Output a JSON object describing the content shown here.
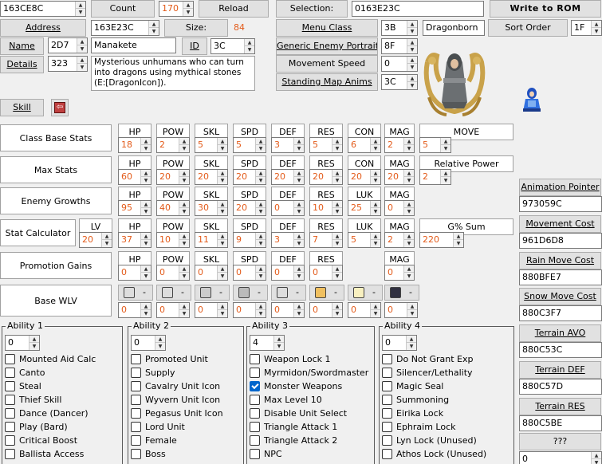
{
  "top": {
    "address_value": "163CE8C",
    "count_label": "Count",
    "count_value": "170",
    "reload_label": "Reload",
    "selection_label": "Selection:",
    "selection_value": "0163E23C",
    "write_label": "Write to ROM"
  },
  "row2": {
    "address_label": "Address",
    "address_value": "163E23C",
    "size_label": "Size:",
    "size_value": "84",
    "menu_class_label": "Menu Class",
    "menu_class_value": "3B",
    "menu_class_name": "Dragonborn",
    "sort_label": "Sort Order",
    "sort_value": "1F"
  },
  "row3": {
    "name_label": "Name",
    "name_id": "2D7",
    "name_value": "Manakete",
    "id_label": "ID",
    "id_value": "3C",
    "portrait_label": "Generic Enemy Portrait",
    "portrait_value": "8F"
  },
  "row4": {
    "details_label": "Details",
    "details_id": "323",
    "details_text": "Mysterious unhumans who can turn into dragons using mythical stones (E:[DragonIcon]).",
    "move_speed_label": "Movement Speed",
    "move_speed_value": "0",
    "standing_label": "Standing Map Anims",
    "standing_value": "3C"
  },
  "skill_label": "Skill",
  "stats": {
    "base": {
      "label": "Class Base Stats",
      "headers": [
        "HP",
        "POW",
        "SKL",
        "SPD",
        "DEF",
        "RES",
        "CON",
        "MAG",
        "MOVE"
      ],
      "values": [
        "18",
        "2",
        "5",
        "5",
        "3",
        "5",
        "6",
        "2",
        "5"
      ]
    },
    "max": {
      "label": "Max Stats",
      "headers": [
        "HP",
        "POW",
        "SKL",
        "SPD",
        "DEF",
        "RES",
        "CON",
        "MAG",
        "Relative Power"
      ],
      "values": [
        "60",
        "20",
        "20",
        "20",
        "20",
        "20",
        "20",
        "20",
        "2"
      ]
    },
    "growth": {
      "label": "Enemy Growths",
      "headers": [
        "HP",
        "POW",
        "SKL",
        "SPD",
        "DEF",
        "RES",
        "LUK",
        "MAG"
      ],
      "values": [
        "95",
        "40",
        "30",
        "20",
        "0",
        "10",
        "25",
        "0"
      ]
    },
    "calc": {
      "label": "Stat Calculator",
      "lv_label": "LV",
      "lv_value": "20",
      "headers": [
        "HP",
        "POW",
        "SKL",
        "SPD",
        "DEF",
        "RES",
        "LUK",
        "MAG",
        "G% Sum"
      ],
      "values": [
        "37",
        "10",
        "11",
        "9",
        "3",
        "7",
        "5",
        "2",
        "220"
      ]
    },
    "promo": {
      "label": "Promotion Gains",
      "headers": [
        "HP",
        "POW",
        "SKL",
        "SPD",
        "DEF",
        "RES",
        "MAG"
      ],
      "values": [
        "0",
        "0",
        "0",
        "0",
        "0",
        "0",
        "0"
      ]
    },
    "wlv": {
      "label": "Base WLV",
      "icons": [
        "sword-icon",
        "lance-icon",
        "axe-icon",
        "bow-icon",
        "staff-icon",
        "anima-icon",
        "light-icon",
        "dark-icon"
      ],
      "dash": "-",
      "values": [
        "0",
        "0",
        "0",
        "0",
        "0",
        "0",
        "0",
        "0"
      ]
    }
  },
  "abilities": [
    {
      "title": "Ability 1",
      "value": "0",
      "items": [
        {
          "t": "Mounted Aid Calc",
          "c": false
        },
        {
          "t": "Canto",
          "c": false
        },
        {
          "t": "Steal",
          "c": false
        },
        {
          "t": "Thief Skill",
          "c": false
        },
        {
          "t": "Dance (Dancer)",
          "c": false
        },
        {
          "t": "Play (Bard)",
          "c": false
        },
        {
          "t": "Critical Boost",
          "c": false
        },
        {
          "t": "Ballista Access",
          "c": false
        }
      ]
    },
    {
      "title": "Ability 2",
      "value": "0",
      "items": [
        {
          "t": "Promoted Unit",
          "c": false
        },
        {
          "t": "Supply",
          "c": false
        },
        {
          "t": "Cavalry Unit Icon",
          "c": false
        },
        {
          "t": "Wyvern Unit Icon",
          "c": false
        },
        {
          "t": "Pegasus Unit Icon",
          "c": false
        },
        {
          "t": "Lord Unit",
          "c": false
        },
        {
          "t": "Female",
          "c": false
        },
        {
          "t": "Boss",
          "c": false
        }
      ]
    },
    {
      "title": "Ability 3",
      "value": "4",
      "items": [
        {
          "t": "Weapon Lock 1",
          "c": false
        },
        {
          "t": "Myrmidon/Swordmaster",
          "c": false
        },
        {
          "t": "Monster Weapons",
          "c": true
        },
        {
          "t": "Max Level 10",
          "c": false
        },
        {
          "t": "Disable Unit Select",
          "c": false
        },
        {
          "t": "Triangle Attack 1",
          "c": false
        },
        {
          "t": "Triangle Attack 2",
          "c": false
        },
        {
          "t": "NPC",
          "c": false
        }
      ]
    },
    {
      "title": "Ability 4",
      "value": "0",
      "items": [
        {
          "t": "Do Not Grant Exp",
          "c": false
        },
        {
          "t": "Silencer/Lethality",
          "c": false
        },
        {
          "t": "Magic Seal",
          "c": false
        },
        {
          "t": "Summoning",
          "c": false
        },
        {
          "t": "Eirika Lock",
          "c": false
        },
        {
          "t": "Ephraim Lock",
          "c": false
        },
        {
          "t": "Lyn Lock (Unused)",
          "c": false
        },
        {
          "t": "Athos Lock (Unused)",
          "c": false
        }
      ]
    }
  ],
  "side": [
    {
      "label": "Animation Pointer",
      "value": "973059C"
    },
    {
      "label": "Movement Cost",
      "value": "961D6D8"
    },
    {
      "label": "Rain Move Cost",
      "value": "880BFE7"
    },
    {
      "label": "Snow Move Cost",
      "value": "880C3F7"
    },
    {
      "label": "Terrain AVO",
      "value": "880C53C"
    },
    {
      "label": "Terrain DEF",
      "value": "880C57D"
    },
    {
      "label": "Terrain RES",
      "value": "880C5BE"
    },
    {
      "label": "???",
      "value": "0"
    }
  ],
  "colors": {
    "accent_value": "#e35b1a",
    "checkbox_on": "#0066cc"
  }
}
